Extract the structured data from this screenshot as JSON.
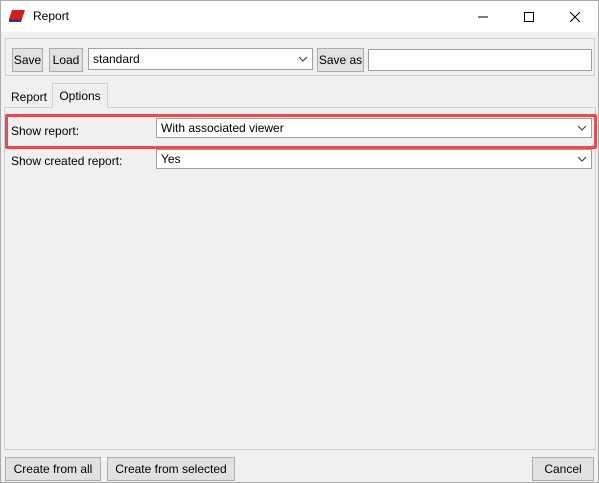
{
  "window": {
    "title": "Report",
    "accent_color": "#d01f1f"
  },
  "toolbar": {
    "save_label": "Save",
    "load_label": "Load",
    "preset_value": "standard",
    "save_as_label": "Save as",
    "save_as_value": ""
  },
  "tabs": {
    "report_label": "Report",
    "options_label": "Options",
    "active": "Options"
  },
  "options": {
    "show_report_label": "Show report:",
    "show_report_value": "With associated viewer",
    "show_created_report_label": "Show created report:",
    "show_created_report_value": "Yes"
  },
  "footer": {
    "create_from_all_label": "Create from all",
    "create_from_selected_label": "Create from selected",
    "cancel_label": "Cancel"
  },
  "icons": {
    "app": "report-app-icon",
    "minimize": "minimize-icon",
    "maximize": "maximize-icon",
    "close": "close-icon",
    "dropdown": "chevron-down-icon"
  }
}
